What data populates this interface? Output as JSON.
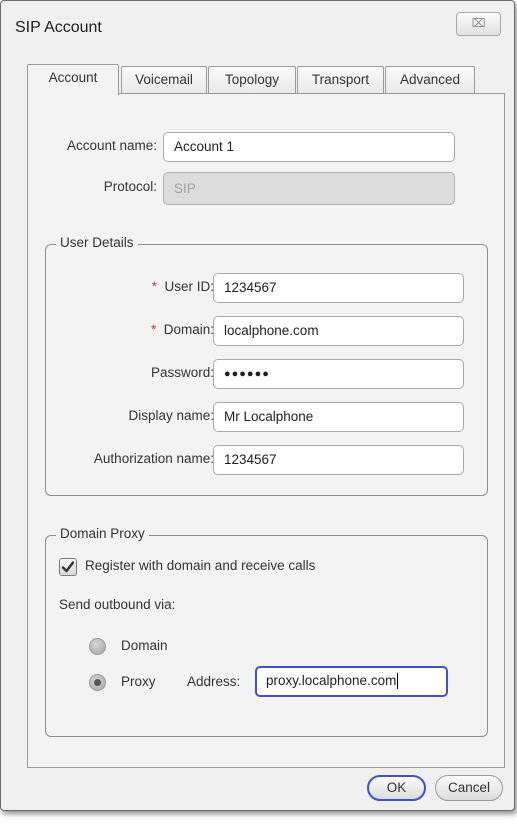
{
  "window": {
    "title": "SIP Account",
    "close_glyph": "⌧"
  },
  "tabs": [
    {
      "label": "Account"
    },
    {
      "label": "Voicemail"
    },
    {
      "label": "Topology"
    },
    {
      "label": "Transport"
    },
    {
      "label": "Advanced"
    }
  ],
  "account": {
    "account_name_label": "Account name:",
    "account_name_value": "Account 1",
    "protocol_label": "Protocol:",
    "protocol_value": "SIP"
  },
  "user_details": {
    "legend": "User Details",
    "required_mark": "*",
    "user_id_label": "User ID:",
    "user_id_value": "1234567",
    "domain_label": "Domain:",
    "domain_value": "localphone.com",
    "password_label": "Password:",
    "password_value": "●●●●●●",
    "display_name_label": "Display name:",
    "display_name_value": "Mr Localphone",
    "auth_name_label": "Authorization name:",
    "auth_name_value": "1234567"
  },
  "domain_proxy": {
    "legend": "Domain Proxy",
    "register_label": "Register with domain and receive calls",
    "register_checked": true,
    "send_via_label": "Send outbound via:",
    "option_domain": "Domain",
    "option_proxy": "Proxy",
    "selected": "Proxy",
    "address_label": "Address:",
    "address_value": "proxy.localphone.com"
  },
  "footer": {
    "ok_label": "OK",
    "cancel_label": "Cancel"
  },
  "colors": {
    "accent": "#3f51c5",
    "required": "#e03030"
  }
}
